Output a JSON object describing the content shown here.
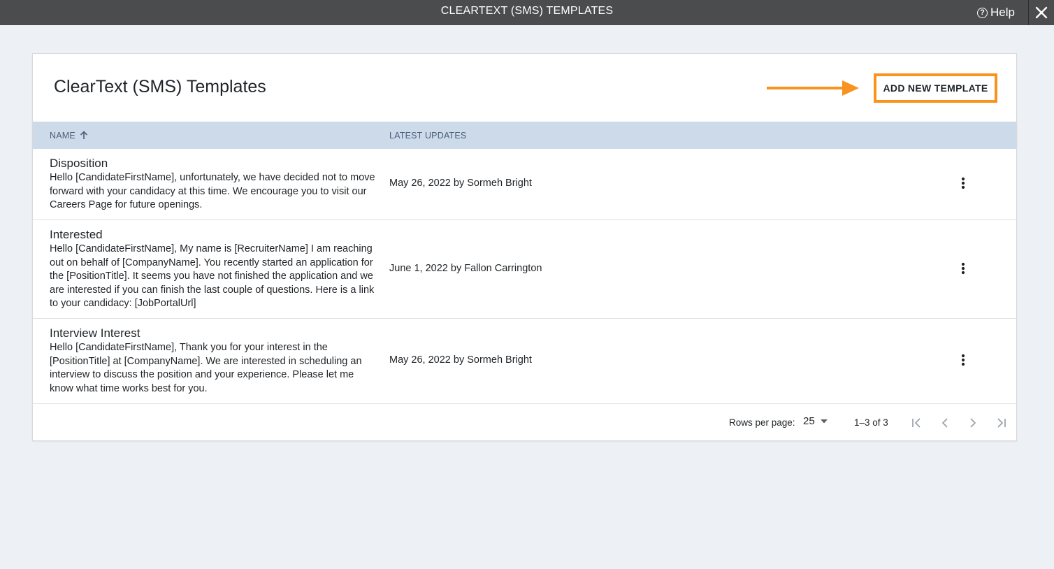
{
  "window": {
    "title": "CLEARTEXT (SMS) TEMPLATES",
    "help_label": "Help",
    "help_icon": "question-circle-icon",
    "close_icon": "close-icon"
  },
  "page": {
    "title": "ClearText (SMS) Templates",
    "add_button_label": "ADD NEW TEMPLATE",
    "accent_color": "#f7931e"
  },
  "table": {
    "columns": [
      {
        "label": "NAME",
        "sort": "ascending"
      },
      {
        "label": "LATEST UPDATES"
      }
    ],
    "rows": [
      {
        "name": "Disposition",
        "body": "Hello [CandidateFirstName], unfortunately, we have decided not to move forward with your candidacy at this time. We encourage you to visit our Careers Page for future openings.",
        "updated": "May 26, 2022 by Sormeh Bright"
      },
      {
        "name": "Interested",
        "body": "Hello [CandidateFirstName], My name is [RecruiterName] I am reaching out on behalf of [CompanyName]. You recently started an application for the [PositionTitle]. It seems you have not finished the application and we are interested if you can finish the last couple of questions. Here is a link to your candidacy: [JobPortalUrl]",
        "updated": "June 1, 2022 by Fallon Carrington"
      },
      {
        "name": "Interview Interest",
        "body": "Hello [CandidateFirstName], Thank you for your interest in the [PositionTitle] at [CompanyName]. We are interested in scheduling an interview to discuss the position and your experience. Please let me know what time works best for you.",
        "updated": "May 26, 2022 by Sormeh Bright"
      }
    ]
  },
  "pagination": {
    "rows_per_page_label": "Rows per page:",
    "rows_per_page_value": "25",
    "range_label": "1–3 of 3"
  }
}
